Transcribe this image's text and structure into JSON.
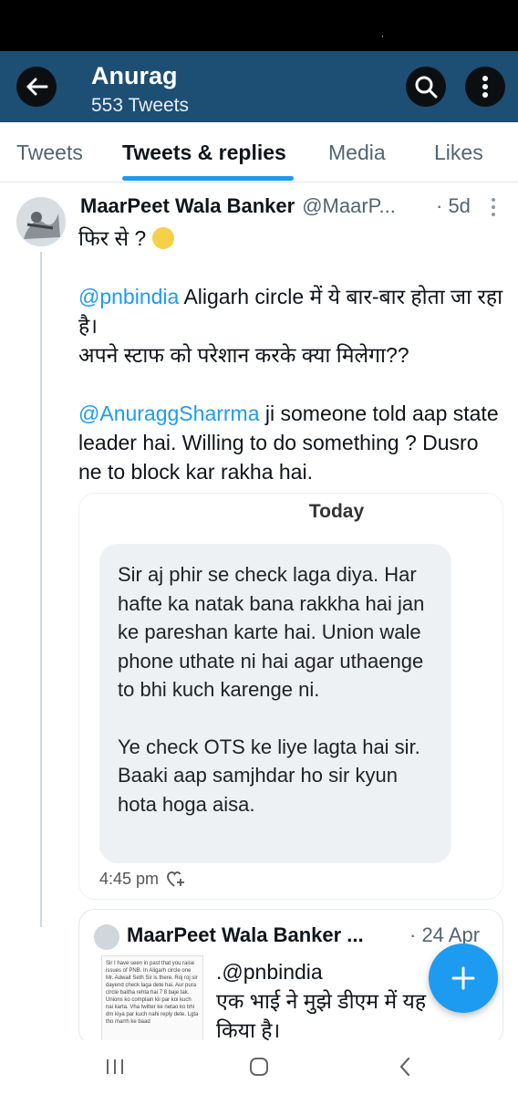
{
  "header": {
    "title": "Anurag",
    "subtitle": "553 Tweets"
  },
  "tabs": [
    {
      "label": "Tweets"
    },
    {
      "label": "Tweets & replies"
    },
    {
      "label": "Media"
    },
    {
      "label": "Likes"
    }
  ],
  "tweet": {
    "author": "MaarPeet Wala Banker",
    "handle": "@MaarP...",
    "time": "· 5d",
    "line1": "फिर से ?",
    "para2_mention": "@pnbindia",
    "para2_text": " Aligarh circle में ये बार-बार होता जा रहा है।",
    "para2_line2": "अपने स्टाफ को परेशान करके क्या मिलेगा??",
    "para3_mention": "@AnuraggSharrma",
    "para3_text": " ji someone told aap state leader hai. Willing to do something ? Dusro ne to block kar rakha hai."
  },
  "screenshot": {
    "day": "Today",
    "msg1": "Sir aj phir se check laga diya. Har hafte ka natak bana rakkha hai jan ke pareshan karte hai. Union wale phone uthate ni hai agar uthaenge to bhi kuch karenge ni.",
    "msg2": "Ye check OTS ke liye lagta hai sir. Baaki aap samjhdar ho sir kyun hota hoga aisa.",
    "time": "4:45 pm"
  },
  "quote": {
    "author": "MaarPeet Wala Banker ...",
    "time": "· 24 Apr",
    "line1": ".@pnbindia",
    "line2": "एक भाई ने मुझे डीएम में यह",
    "line3": "किया है।",
    "thumb_text": "Sir I have seen in past that you raise issues of PNB. In Aligarh circle one Mr. Adwait Seth Sir is there. Roj roj sir dayend check laga dete hai. Aur pura circle baitha rehta hai 7 8 baje tak. Unions ko complain kii par koi kuch nai karta. Vha twitter ke netao ko bhi dm kiya par kuch nahi reply dete. Lgta tho marrh ke baad"
  }
}
